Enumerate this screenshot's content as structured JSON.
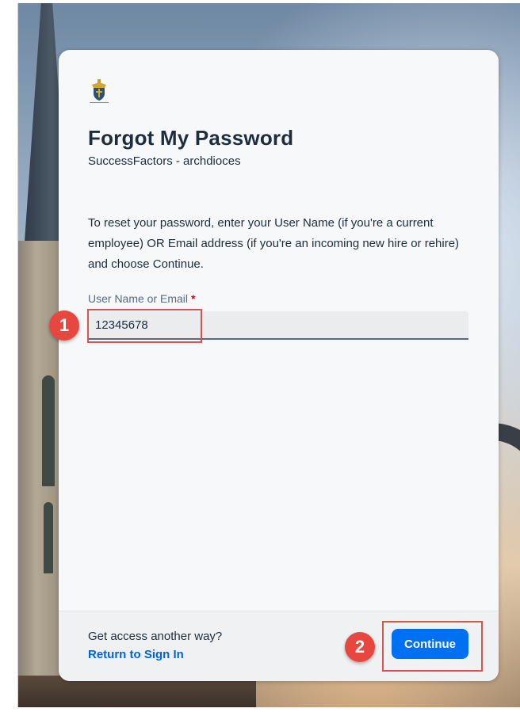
{
  "page": {
    "title": "Forgot My Password",
    "subtitle": "SuccessFactors - archdioces",
    "instructions": "To reset your password, enter your User Name (if you're a current employee) OR Email address (if you're an incoming new hire or rehire) and choose Continue."
  },
  "form": {
    "field_label": "User Name or Email",
    "required_marker": "*",
    "field_value": "12345678"
  },
  "footer": {
    "alt_text": "Get access another way?",
    "return_link": "Return to Sign In",
    "continue_label": "Continue"
  },
  "annotations": {
    "step1": "1",
    "step2": "2"
  },
  "icons": {
    "logo": "archdiocese-crest-icon"
  },
  "colors": {
    "primary_button": "#0070f2",
    "link": "#0064d9",
    "title_text": "#1d2d3e",
    "required": "#d20a0a",
    "annotation": "#e8473f"
  }
}
